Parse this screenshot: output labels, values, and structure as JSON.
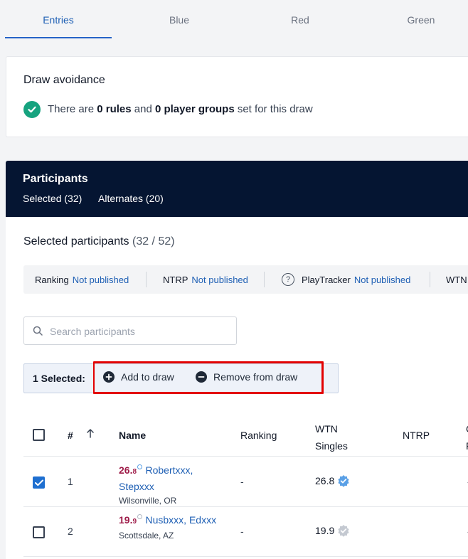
{
  "tabs": [
    {
      "label": "Entries",
      "active": true
    },
    {
      "label": "Blue",
      "active": false
    },
    {
      "label": "Red",
      "active": false
    },
    {
      "label": "Green",
      "active": false
    }
  ],
  "draw_avoidance": {
    "title": "Draw avoidance",
    "text_prefix": "There are",
    "rules": "0 rules",
    "text_mid": "and",
    "groups": "0 player groups",
    "text_suffix": "set for this draw"
  },
  "participants": {
    "title": "Participants",
    "selected_link": "Selected (32)",
    "alternates_link": "Alternates (20)"
  },
  "selected_section": {
    "title": "Selected participants",
    "count": "(32 / 52)"
  },
  "rankings": [
    {
      "label": "Ranking",
      "status": "Not published"
    },
    {
      "label": "NTRP",
      "status": "Not published"
    },
    {
      "label": "PlayTracker",
      "status": "Not published"
    },
    {
      "label": "WTN",
      "status": ""
    }
  ],
  "search": {
    "placeholder": "Search participants",
    "value": ""
  },
  "selection_bar": {
    "count_label": "1 Selected:",
    "add_label": "Add to draw",
    "remove_label": "Remove from draw"
  },
  "table": {
    "headers": {
      "num": "#",
      "name": "Name",
      "ranking": "Ranking",
      "wtn_line1": "WTN",
      "wtn_line2": "Singles",
      "ntrp": "NTRP",
      "edge1": "C",
      "edge2": "P"
    },
    "rows": [
      {
        "num": "1",
        "rating_main": "26.",
        "rating_dec": "8",
        "name": "Robertxxx, Stepxxx",
        "location": "Wilsonville, OR",
        "ranking": "-",
        "wtn": "26.8",
        "verified": true,
        "checked": true,
        "edge": "-"
      },
      {
        "num": "2",
        "rating_main": "19.",
        "rating_dec": "9",
        "name": "Nusbxxx, Edxxx",
        "location": "Scottsdale, AZ",
        "ranking": "-",
        "wtn": "19.9",
        "verified": false,
        "checked": false,
        "edge": "-"
      }
    ]
  },
  "colors": {
    "accent": "#1e5fb4",
    "header_bg": "#051532",
    "success": "#16a37f",
    "highlight": "#e30000"
  }
}
